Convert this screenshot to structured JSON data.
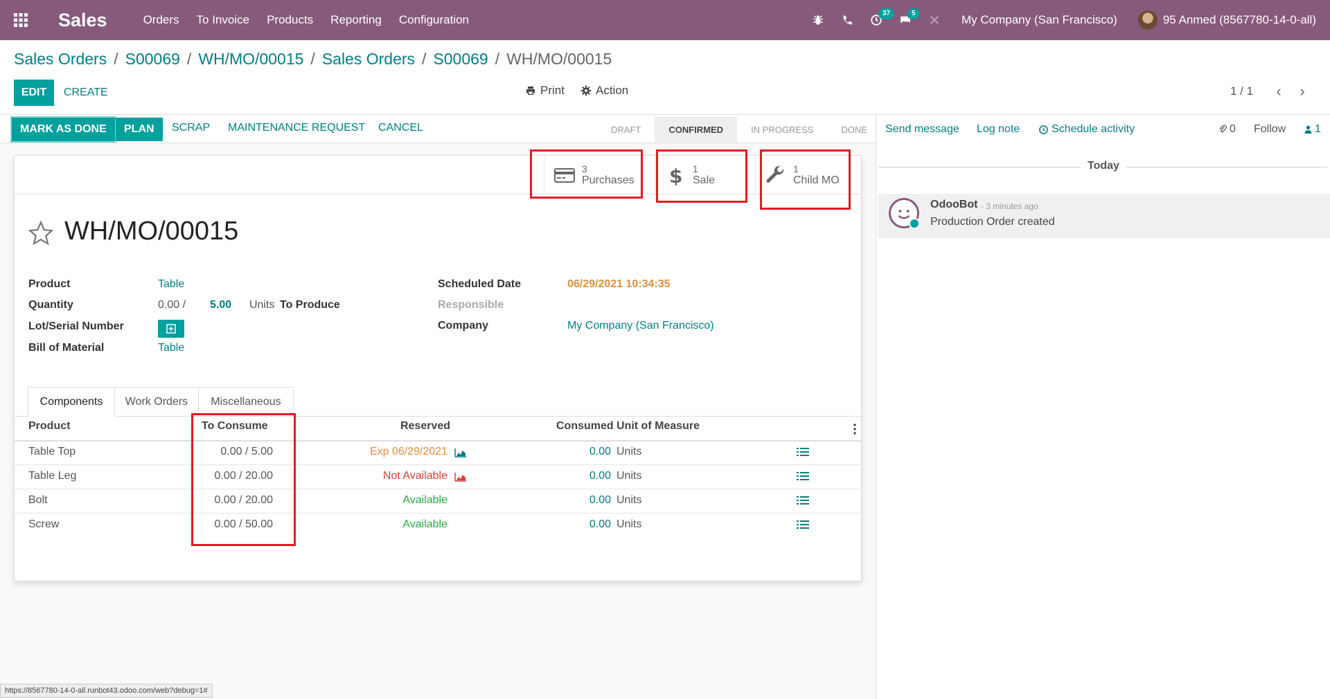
{
  "app": {
    "title": "Sales"
  },
  "nav": {
    "items": [
      "Orders",
      "To Invoice",
      "Products",
      "Reporting",
      "Configuration"
    ]
  },
  "systray": {
    "activity_badge": "37",
    "messages_badge": "5",
    "company": "My Company (San Francisco)",
    "user": "95 Anmed (8567780-14-0-all)"
  },
  "breadcrumb": [
    "Sales Orders",
    "S00069",
    "WH/MO/00015",
    "Sales Orders",
    "S00069",
    "WH/MO/00015"
  ],
  "controls": {
    "edit": "EDIT",
    "create": "CREATE",
    "print": "Print",
    "action": "Action",
    "pager": "1 / 1"
  },
  "statusbar": {
    "buttons": [
      "MARK AS DONE",
      "PLAN",
      "SCRAP",
      "MAINTENANCE REQUEST",
      "CANCEL"
    ],
    "stages": [
      "DRAFT",
      "CONFIRMED",
      "IN PROGRESS",
      "DONE"
    ],
    "current_stage": "CONFIRMED"
  },
  "chatter": {
    "send_message": "Send message",
    "log_note": "Log note",
    "schedule_activity": "Schedule activity",
    "attachments": "0",
    "follow": "Follow",
    "followers": "1",
    "date_separator": "Today",
    "messages": [
      {
        "author": "OdooBot",
        "ago": "- 3 minutes ago",
        "body": "Production Order created"
      }
    ]
  },
  "smart_buttons": [
    {
      "count": "3",
      "label": "Purchases",
      "icon": "credit-card-icon"
    },
    {
      "count": "1",
      "label": "Sale",
      "icon": "dollar-icon"
    },
    {
      "count": "1",
      "label": "Child MO",
      "icon": "wrench-icon"
    }
  ],
  "record": {
    "name": "WH/MO/00015",
    "fields": {
      "product_label": "Product",
      "product": "Table",
      "quantity_label": "Quantity",
      "qty_produced": "0.00 /",
      "qty_to_produce": "5.00",
      "uom": "Units",
      "to_produce": "To Produce",
      "lot_label": "Lot/Serial Number",
      "bom_label": "Bill of Material",
      "bom": "Table",
      "scheduled_label": "Scheduled Date",
      "scheduled": "06/29/2021 10:34:35",
      "responsible_label": "Responsible",
      "company_label": "Company",
      "company": "My Company (San Francisco)"
    }
  },
  "tabs": [
    "Components",
    "Work Orders",
    "Miscellaneous"
  ],
  "components": {
    "headers": [
      "Product",
      "To Consume",
      "Reserved",
      "Consumed",
      "Unit of Measure"
    ],
    "rows": [
      {
        "product": "Table Top",
        "to_consume": "0.00 / 5.00",
        "reserved": "Exp 06/29/2021",
        "consumed": "0.00",
        "uom": "Units"
      },
      {
        "product": "Table Leg",
        "to_consume": "0.00 / 20.00",
        "reserved": "Not Available",
        "consumed": "0.00",
        "uom": "Units"
      },
      {
        "product": "Bolt",
        "to_consume": "0.00 / 20.00",
        "reserved": "Available",
        "consumed": "0.00",
        "uom": "Units"
      },
      {
        "product": "Screw",
        "to_consume": "0.00 / 50.00",
        "reserved": "Available",
        "consumed": "0.00",
        "uom": "Units"
      }
    ]
  },
  "status_url": "https://8567780-14-0-all.runbot43.odoo.com/web?debug=1#",
  "colors": {
    "brand": "#875a7b",
    "accent": "#00a09d",
    "link": "#017e84",
    "highlight": "#e01b24"
  }
}
